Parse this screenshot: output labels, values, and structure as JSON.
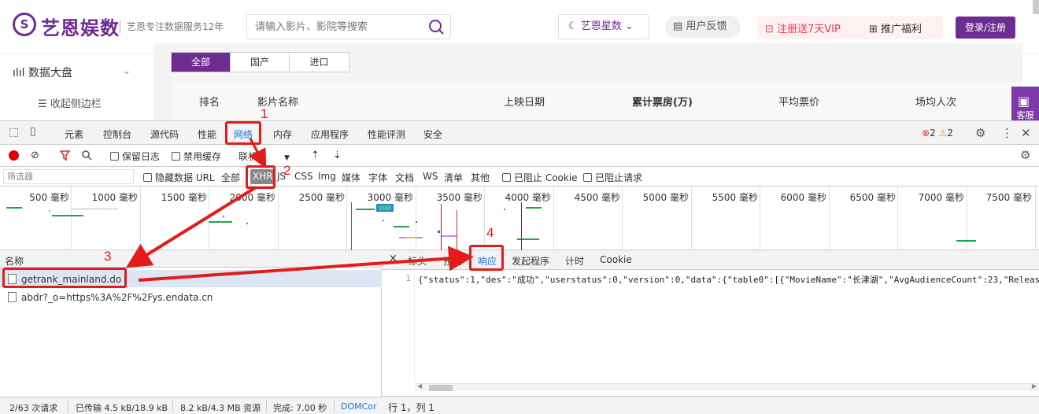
{
  "site": {
    "logo_glyph": "S",
    "logo_text": "艺恩娱数",
    "slogan": "艺恩专注数据服务12年",
    "search_placeholder": "请输入影片、影院等搜索",
    "star_label": "艺恩星数",
    "feedback_label": "用户反馈",
    "vip_label": "注册送7天VIP",
    "promo_label": "推广福利",
    "login_label": "登录/注册",
    "service_label": "客服",
    "accent": "#6e2c91"
  },
  "sidebar": {
    "dashboard_label": "数据大盘",
    "collapse_label": "收起侧边栏"
  },
  "content": {
    "tabs": [
      "全部",
      "国产",
      "进口"
    ],
    "columns": [
      "排名",
      "影片名称",
      "上映日期",
      "累计票房(万)",
      "平均票价",
      "场均人次"
    ]
  },
  "devtools": {
    "tabs": [
      "元素",
      "控制台",
      "源代码",
      "性能",
      "网络",
      "内存",
      "应用程序",
      "性能评测",
      "安全"
    ],
    "error_count": "2",
    "warning_count": "2",
    "toolbar": {
      "preserve_log": "保留日志",
      "disable_cache": "禁用缓存",
      "throttle": "联机"
    },
    "filter": {
      "placeholder": "筛选器",
      "hide_data_urls": "隐藏数据 URL",
      "types": [
        "全部",
        "XHR",
        "JS",
        "CSS",
        "Img",
        "媒体",
        "字体",
        "文档",
        "WS",
        "清单",
        "其他"
      ],
      "blocked_cookies": "已阻止 Cookie",
      "blocked_requests": "已阻止请求"
    },
    "timeline_labels": [
      "500 毫秒",
      "1000 毫秒",
      "1500 毫秒",
      "2000 毫秒",
      "2500 毫秒",
      "3000 毫秒",
      "3500 毫秒",
      "4000 毫秒",
      "4500 毫秒",
      "5000 毫秒",
      "5500 毫秒",
      "6000 毫秒",
      "6500 毫秒",
      "7000 毫秒",
      "7500 毫秒"
    ],
    "names_header": "名称",
    "requests": [
      "getrank_mainland.do",
      "abdr?_o=https%3A%2F%2Fys.endata.cn"
    ],
    "status": {
      "requests": "2/63 次请求",
      "transferred": "已传输 4.5 kB/18.9 kB",
      "resources": "8.2 kB/4.3 MB 资源",
      "finish": "完成: 7.00 秒",
      "domcontent": "DOMCor"
    },
    "detail_tabs": [
      "标头",
      "预览",
      "响应",
      "发起程序",
      "计时",
      "Cookie"
    ],
    "close_glyph": "×",
    "line_number": "1",
    "response_line": "{\"status\":1,\"des\":\"成功\",\"userstatus\":0,\"version\":0,\"data\":{\"table0\":[{\"MovieName\":\"长津湖\",\"AvgAudienceCount\":23,\"Releas",
    "cursor_position": "行 1，列 1"
  },
  "annotations": [
    "1",
    "2",
    "3",
    "4"
  ]
}
